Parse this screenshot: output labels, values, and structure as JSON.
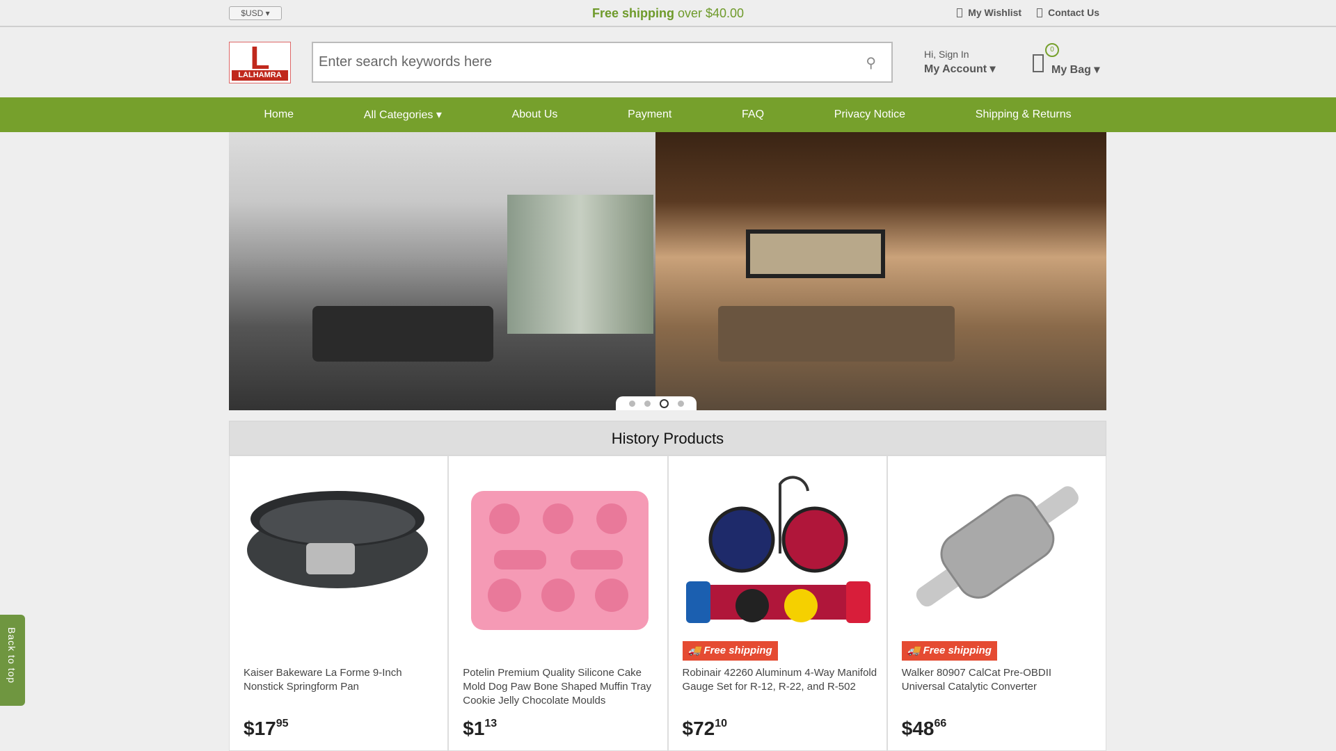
{
  "topbar": {
    "currency": "$USD",
    "free_shipping_bold": "Free shipping",
    "free_shipping_rest": " over $40.00",
    "wishlist": "My Wishlist",
    "contact": "Contact Us"
  },
  "header": {
    "logo_letter": "L",
    "logo_name": "LALHAMRA",
    "search_placeholder": "Enter search keywords here",
    "greeting": "Hi, Sign In",
    "account": "My Account",
    "bag_count": "0",
    "bag": "My Bag"
  },
  "nav": [
    "Home",
    "All Categories",
    "About Us",
    "Payment",
    "FAQ",
    "Privacy Notice",
    "Shipping & Returns"
  ],
  "carousel": {
    "slides": 4,
    "active": 3
  },
  "history": {
    "title": "History Products",
    "products": [
      {
        "name": "Kaiser Bakeware La Forme 9-Inch Nonstick Springform Pan",
        "price_main": "$17",
        "price_cents": "95",
        "badge": ""
      },
      {
        "name": "Potelin Premium Quality Silicone Cake Mold Dog Paw Bone Shaped Muffin Tray Cookie Jelly Chocolate Moulds",
        "price_main": "$1",
        "price_cents": "13",
        "badge": ""
      },
      {
        "name": "Robinair 42260 Aluminum 4-Way Manifold Gauge Set for R-12, R-22, and R-502",
        "price_main": "$72",
        "price_cents": "10",
        "badge": "Free shipping"
      },
      {
        "name": "Walker 80907 CalCat Pre-OBDII Universal Catalytic Converter",
        "price_main": "$48",
        "price_cents": "66",
        "badge": "Free shipping"
      }
    ]
  },
  "back_to_top": "Back to top",
  "colors": {
    "brand_green": "#76a02c",
    "badge_red": "#e54b32",
    "logo_red": "#c0281c"
  }
}
